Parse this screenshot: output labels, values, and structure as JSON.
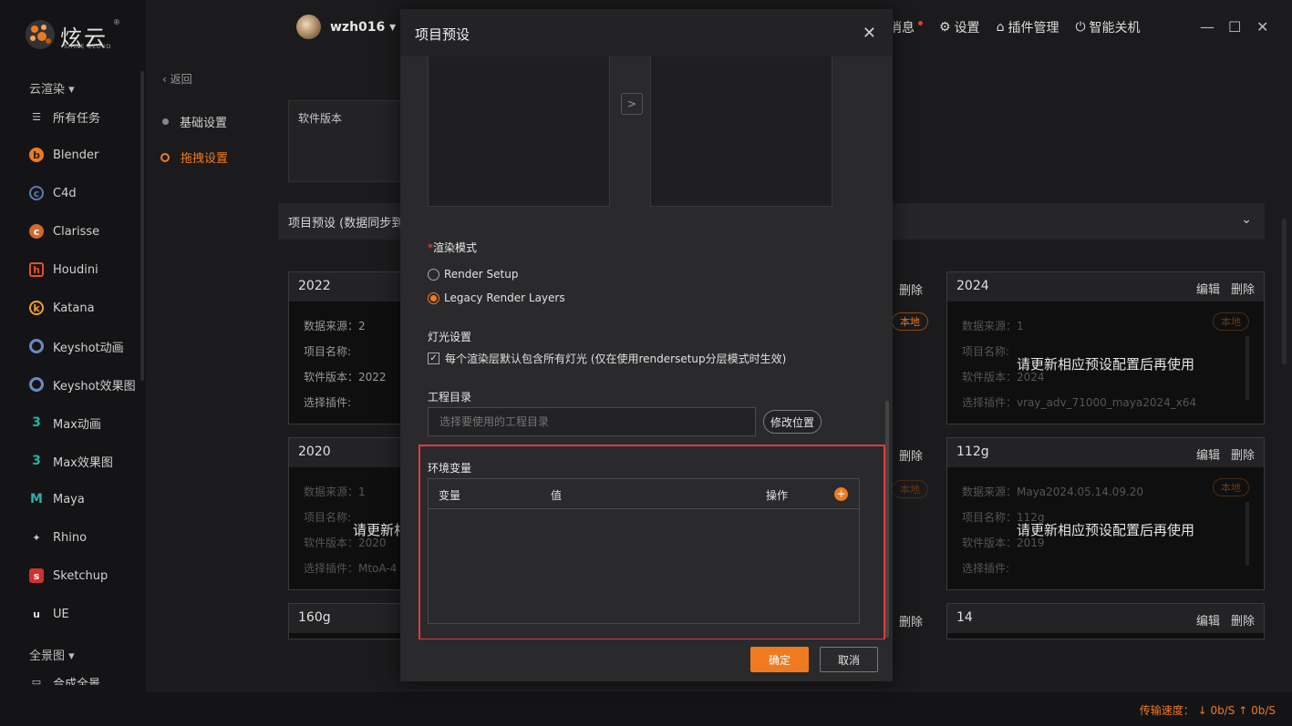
{
  "brand": {
    "name_cn": "炫云",
    "name_en": "SHINE CLOUD",
    "reg": "®"
  },
  "sidebar": {
    "section1": "云渲染 ▾",
    "items": [
      {
        "label": "所有任务",
        "icon": "list-icon"
      },
      {
        "label": "Blender",
        "icon": "blender-icon"
      },
      {
        "label": "C4d",
        "icon": "c4d-icon"
      },
      {
        "label": "Clarisse",
        "icon": "clarisse-icon"
      },
      {
        "label": "Houdini",
        "icon": "houdini-icon"
      },
      {
        "label": "Katana",
        "icon": "katana-icon"
      },
      {
        "label": "Keyshot动画",
        "icon": "keyshot-icon"
      },
      {
        "label": "Keyshot效果图",
        "icon": "keyshot-icon"
      },
      {
        "label": "Max动画",
        "icon": "max-icon"
      },
      {
        "label": "Max效果图",
        "icon": "max-icon"
      },
      {
        "label": "Maya",
        "icon": "maya-icon"
      },
      {
        "label": "Rhino",
        "icon": "rhino-icon"
      },
      {
        "label": "Sketchup",
        "icon": "sketchup-icon"
      },
      {
        "label": "UE",
        "icon": "ue-icon"
      }
    ],
    "section2": "全景图 ▾",
    "partial_item": "合成全景"
  },
  "topbar": {
    "username": "wzh016 ▾",
    "messages_label": "消息",
    "settings_label": "设置",
    "plugins_label": "插件管理",
    "shutdown_label": "智能关机"
  },
  "content": {
    "back_label": "返回",
    "steps": [
      "基础设置",
      "拖拽设置"
    ],
    "software_version_label": "软件版本",
    "preset_bar_title": "项目预设 (数据同步到",
    "cards": [
      {
        "name": "2022",
        "lines": [
          "数据来源：2",
          "项目名称:",
          "软件版本：2022",
          "选择插件:"
        ]
      },
      {
        "name": "2024",
        "lines": [
          "数据来源：1",
          "项目名称:",
          "软件版本：2024",
          "选择插件：vray_adv_71000_maya2024_x64"
        ],
        "overlay": "请更新相应预设配置后再使用",
        "tag": "本地"
      },
      {
        "name": "2020",
        "lines": [
          "数据来源：1",
          "项目名称:",
          "软件版本：2020",
          "选择插件：MtoA-4"
        ],
        "overlay": "请更新相",
        "tag": "本地"
      },
      {
        "name": "112g",
        "lines": [
          "数据来源：Maya2024.05.14.09.20",
          "项目名称：112g",
          "软件版本：2019",
          "选择插件:"
        ],
        "overlay": "请更新相应预设配置后再使用",
        "tag": "本地"
      },
      {
        "name": "160g",
        "lines": []
      },
      {
        "name": "14",
        "lines": []
      }
    ],
    "edit_label": "编辑",
    "delete_label": "删除",
    "local_tag": "本地"
  },
  "footer": {
    "speed_label": "传输速度：",
    "down": "↓ 0b/S",
    "up": "↑ 0b/S"
  },
  "modal": {
    "title": "项目预设",
    "transfer_arrow": ">",
    "render_mode_label": "渲染模式",
    "render_options": [
      "Render Setup",
      "Legacy Render Layers"
    ],
    "render_selected": 1,
    "light_label": "灯光设置",
    "light_check_label": "每个渲染层默认包含所有灯光 (仅在使用rendersetup分层模式时生效)",
    "light_checked": true,
    "project_dir_label": "工程目录",
    "project_dir_placeholder": "选择要使用的工程目录",
    "project_dir_value": "",
    "modify_location_label": "修改位置",
    "env_label": "环境变量",
    "env_columns": [
      "变量",
      "值",
      "操作"
    ],
    "env_add": "+",
    "ok_label": "确定",
    "cancel_label": "取消"
  },
  "colors": {
    "accent": "#f07a1f",
    "highlight": "#e23a3a"
  }
}
